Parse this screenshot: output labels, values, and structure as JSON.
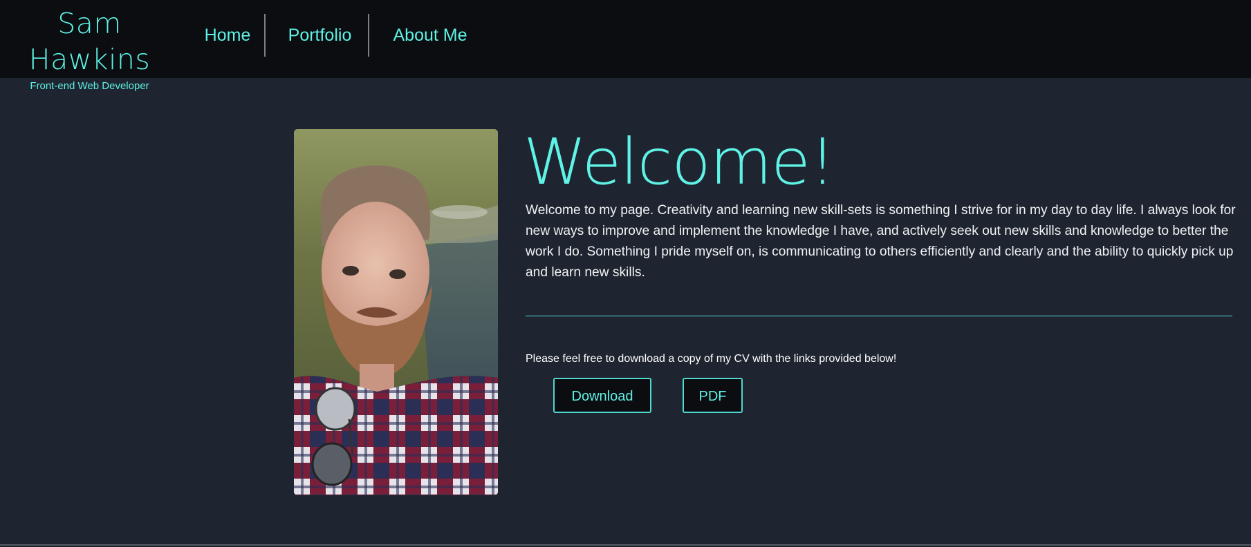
{
  "header": {
    "brand_name": "Sam Hawkins",
    "brand_subtitle": "Front-end Web Developer",
    "nav": [
      {
        "label": "Home"
      },
      {
        "label": "Portfolio"
      },
      {
        "label": "About Me"
      }
    ]
  },
  "main": {
    "title": "Welcome!",
    "intro": "Welcome to my page. Creativity and learning new skill-sets is something I strive for in my day to day life. I always look for new ways to improve and implement the knowledge I have, and actively seek out new skills and knowledge to better the work I do. Something I pride myself on, is communicating to others efficiently and clearly and the ability to quickly pick up and learn new skills.",
    "cv_text": "Please feel free to download a copy of my CV with the links provided below!",
    "buttons": {
      "download": "Download",
      "pdf": "PDF"
    }
  },
  "colors": {
    "accent": "#5ff2e6",
    "header_bg": "#0b0d11",
    "page_bg": "#1f2530"
  }
}
